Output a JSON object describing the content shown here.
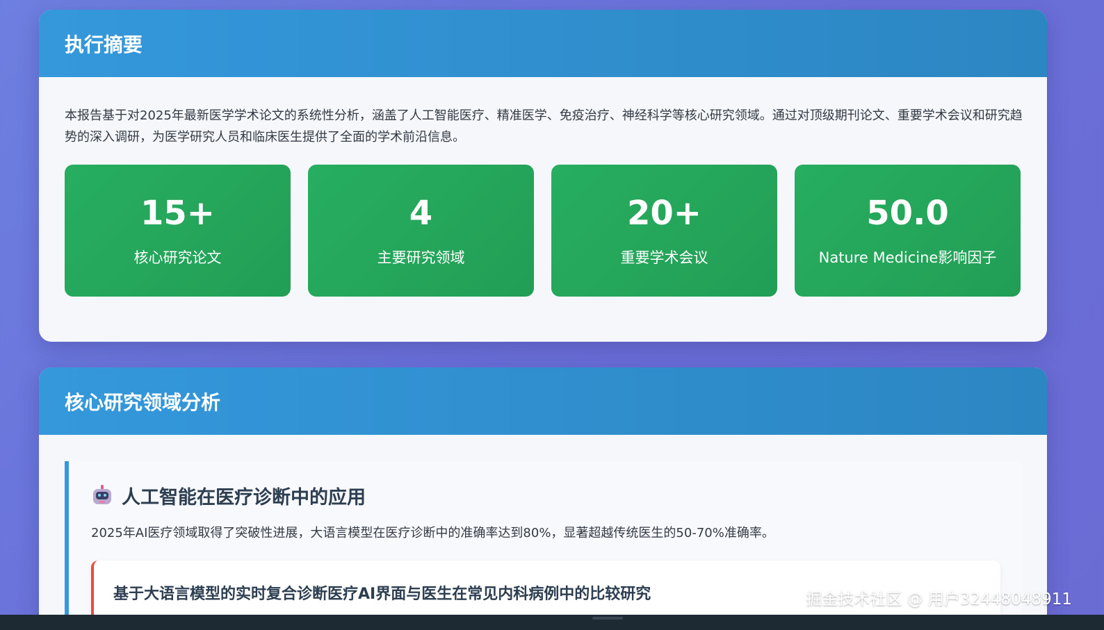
{
  "summary": {
    "title": "执行摘要",
    "text": "本报告基于对2025年最新医学学术论文的系统性分析，涵盖了人工智能医疗、精准医学、免疫治疗、神经科学等核心研究领域。通过对顶级期刊论文、重要学术会议和研究趋势的深入调研，为医学研究人员和临床医生提供了全面的学术前沿信息。",
    "stats": [
      {
        "value": "15+",
        "label": "核心研究论文"
      },
      {
        "value": "4",
        "label": "主要研究领域"
      },
      {
        "value": "20+",
        "label": "重要学术会议"
      },
      {
        "value": "50.0",
        "label": "Nature Medicine影响因子"
      }
    ]
  },
  "areas": {
    "title": "核心研究领域分析",
    "items": [
      {
        "icon": "robot-icon",
        "title": "人工智能在医疗诊断中的应用",
        "description": "2025年AI医疗领域取得了突破性进展，大语言模型在医疗诊断中的准确率达到80%，显著超越传统医生的50-70%准确率。",
        "papers": [
          {
            "title": "基于大语言模型的实时复合诊断医疗AI界面与医生在常见内科病例中的比较研究"
          }
        ]
      }
    ]
  },
  "watermark": "掘金技术社区 @ 用户3244804891​1",
  "colors": {
    "header": "#3498db",
    "stat_card": "#27ae60",
    "area_border": "#3498db",
    "paper_border": "#e74c3c"
  }
}
